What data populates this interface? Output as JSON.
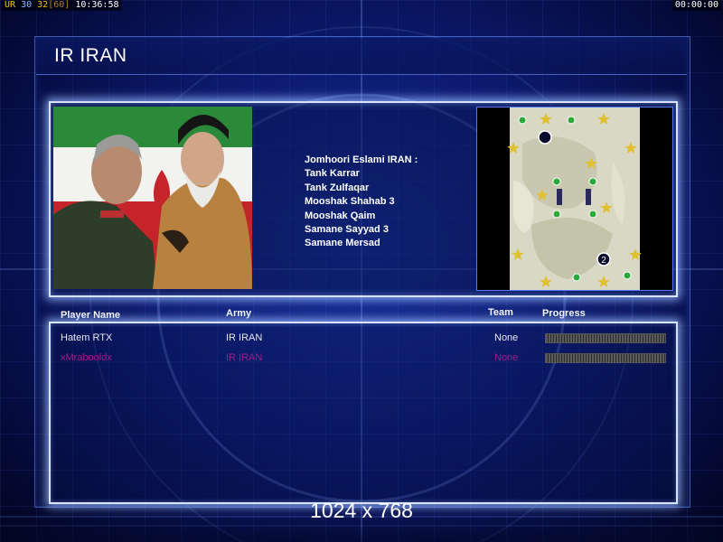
{
  "status_bar": {
    "ur": "UR",
    "fps": "30",
    "frames": "32",
    "frame_cap": "[60]",
    "clock": "10:36:58",
    "timer": "00:00:00"
  },
  "screen": {
    "title": "IR IRAN"
  },
  "army_info": {
    "items": [
      "Jomhoori Eslami IRAN :",
      "Tank Karrar",
      "Tank Zulfaqar",
      "Mooshak Shahab 3",
      "Mooshak Qaim",
      "Samane Sayyad 3",
      "Samane Mersad"
    ]
  },
  "minimap": {
    "player_marker_label": "2"
  },
  "players_table": {
    "headers": {
      "name": "Player Name",
      "army": "Army",
      "team": "Team",
      "progress": "Progress"
    },
    "rows": [
      {
        "name": "Hatem RTX",
        "army": "IR IRAN",
        "team": "None",
        "progress": 1.0,
        "color": "#e8e8f0"
      },
      {
        "name": "xMrabooldx",
        "army": "IR IRAN",
        "team": "None",
        "progress": 1.0,
        "color": "#a01d8a"
      }
    ]
  },
  "resolution_label": "1024 x 768",
  "colors": {
    "frame_glow": "#d8e4ff",
    "background": "#0c1a6e",
    "status_accent": "#f0c000"
  }
}
